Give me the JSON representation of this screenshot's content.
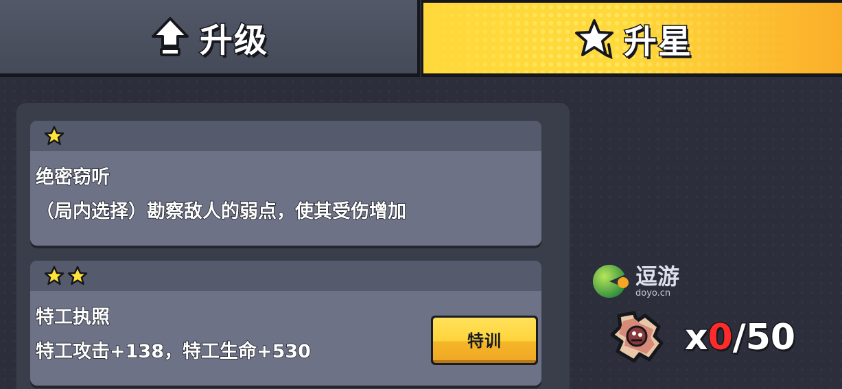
{
  "tabs": {
    "upgrade_label": "升级",
    "star_label": "升星",
    "active": "star"
  },
  "cards": [
    {
      "stars": 1,
      "title": "绝密窃听",
      "description": "（局内选择）勘察敌人的弱点，使其受伤增加"
    },
    {
      "stars": 2,
      "title": "特工执照",
      "description": "特工攻击+138，特工生命+530",
      "button_label": "特训"
    }
  ],
  "watermark": {
    "name": "逗游",
    "url": "doyo.cn"
  },
  "fragments": {
    "prefix": "x",
    "current": "0",
    "separator": "/",
    "required": "50"
  },
  "colors": {
    "active_tab": "#ffd93b",
    "star": "#ffe33a",
    "counter_current": "#ff2b2b"
  }
}
